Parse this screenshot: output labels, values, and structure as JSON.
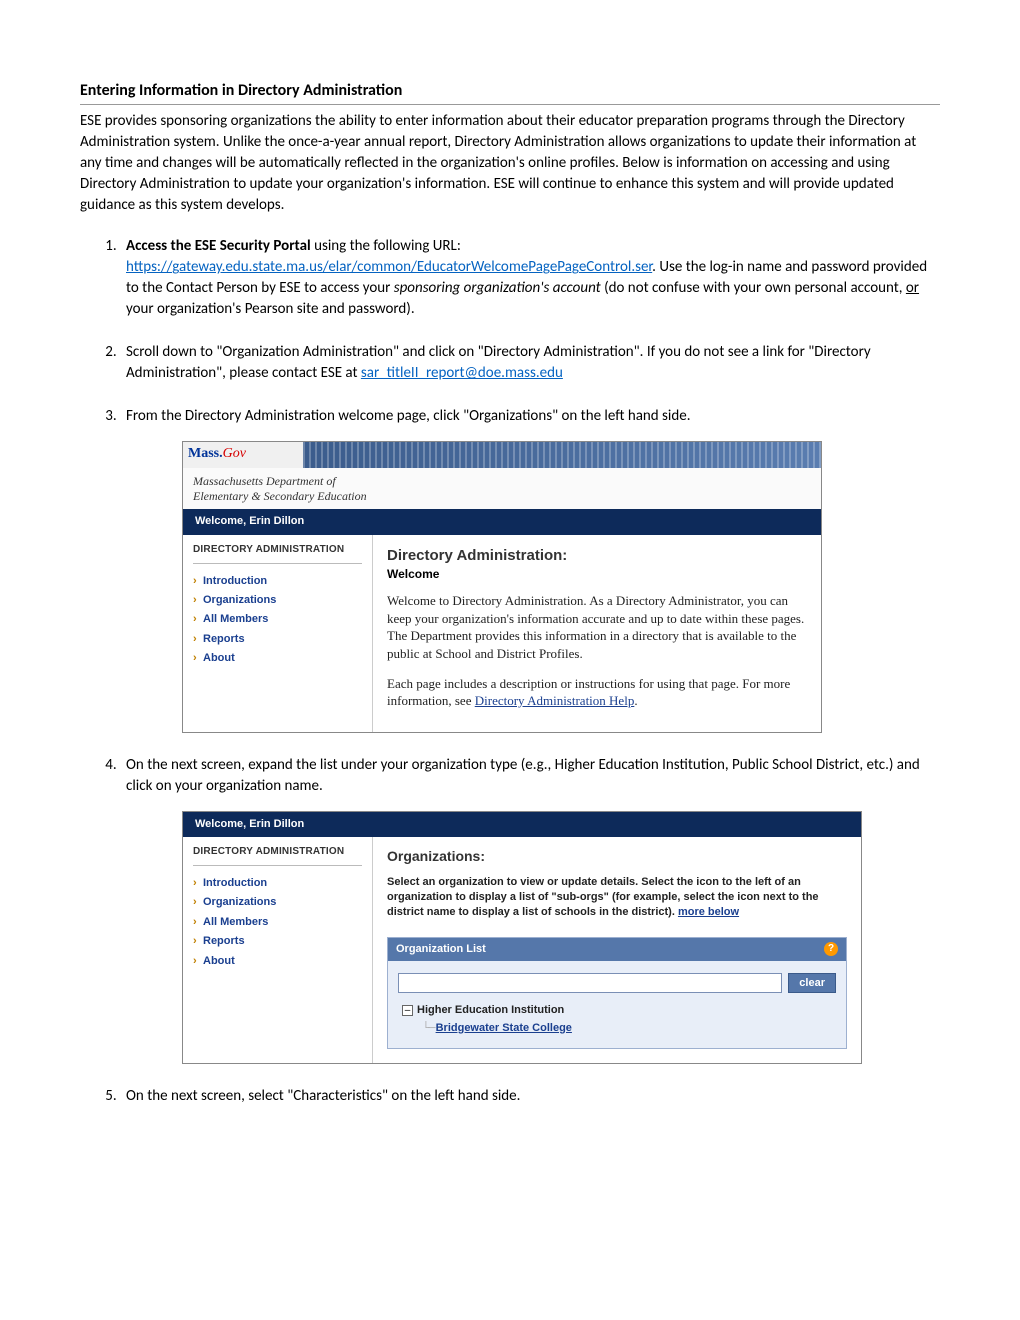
{
  "title": "Entering Information in Directory Administration",
  "intro": "ESE provides sponsoring organizations the ability to enter information about their educator preparation programs through the Directory Administration system. Unlike the once-a-year annual report, Directory Administration allows organizations to update their information at any time and changes will be automatically reflected in the organization's online profiles. Below is information on accessing and using Directory Administration to update your organization's information. ESE will continue to enhance this system and will provide updated guidance as this system develops.",
  "step1": {
    "bold": "Access the ESE Security Portal",
    "text1": " using the following URL: ",
    "url": "https://gateway.edu.state.ma.us/elar/common/EducatorWelcomePagePageControl.ser",
    "text2": ". Use the log-in name and password provided to the Contact Person by ESE to access your ",
    "italic": "sponsoring organization's account",
    "text3": " (do not confuse with your own personal account, ",
    "underline": "or",
    "text4": " your organization's Pearson site and password)."
  },
  "step2": {
    "text1": "Scroll down to \"Organization Administration\" and click on \"Directory Administration\". If you do not see a link for \"Directory Administration\", please contact ESE at ",
    "email": "sar_titleII_report@doe.mass.edu"
  },
  "step3": "From the Directory Administration welcome page, click \"Organizations\" on the left hand side.",
  "step4": "On the next screen, expand the list under your organization type (e.g., Higher Education Institution, Public School District, etc.) and click on your organization name.",
  "step5": "On the next screen, select \"Characteristics\" on the left hand side.",
  "ss1": {
    "logo_mass": "Mass.",
    "logo_gov": "Gov",
    "dept1": "Massachusetts Department of",
    "dept2": "Elementary & Secondary Education",
    "welcome": "Welcome, Erin Dillon",
    "side_title": "DIRECTORY ADMINISTRATION",
    "nav": [
      "Introduction",
      "Organizations",
      "All Members",
      "Reports",
      "About"
    ],
    "main_title": "Directory Administration:",
    "main_sub": "Welcome",
    "p1": "Welcome to Directory Administration. As a Directory Administrator, you can keep your organization's information accurate and up to date within these pages. The Department provides this information in a directory that is available to the public at School and District Profiles.",
    "p2a": "Each page includes a description or instructions for using that page. For more information, see ",
    "p2link": "Directory Administration Help",
    "p2b": "."
  },
  "ss2": {
    "welcome": "Welcome, Erin Dillon",
    "side_title": "DIRECTORY ADMINISTRATION",
    "nav": [
      "Introduction",
      "Organizations",
      "All Members",
      "Reports",
      "About"
    ],
    "main_title": "Organizations:",
    "desc1": "Select an organization to view or update details. Select the icon to the left of an organization to display a list of \"sub-orgs\" (for example, select the icon next to the district name to display a list of schools in the district). ",
    "desc_link": "more below",
    "panel_title": "Organization List",
    "help": "?",
    "clear": "clear",
    "tree_toggle": "–",
    "tree_root": "Higher Education Institution",
    "tree_child": "Bridgewater State College"
  }
}
